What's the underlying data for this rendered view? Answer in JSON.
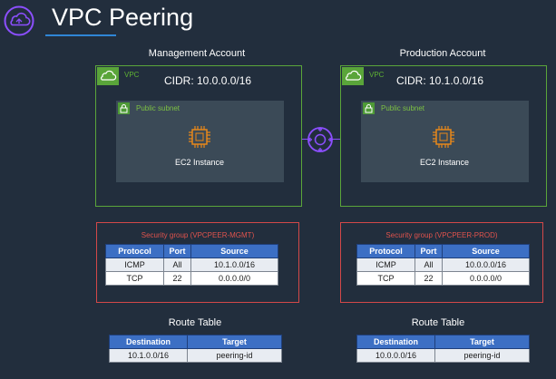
{
  "title": "VPC Peering",
  "accent_color": "#2f86d6",
  "peering_color": "#8c4fff",
  "vpc_border_color": "#5aa53a",
  "sg_border_color": "#d34848",
  "header_fill_color": "#3c6fc4",
  "accounts": [
    {
      "name": "Management Account",
      "vpc_label": "VPC",
      "cidr": "CIDR: 10.0.0.0/16",
      "subnet_label": "Public subnet",
      "instance_label": "EC2 Instance",
      "security_group": {
        "title": "Security group  (VPCPEER-MGMT)",
        "columns": [
          "Protocol",
          "Port",
          "Source"
        ],
        "rows": [
          [
            "ICMP",
            "All",
            "10.1.0.0/16"
          ],
          [
            "TCP",
            "22",
            "0.0.0.0/0"
          ]
        ]
      },
      "route_table": {
        "title": "Route Table",
        "columns": [
          "Destination",
          "Target"
        ],
        "rows": [
          [
            "10.1.0.0/16",
            "peering-id"
          ]
        ]
      }
    },
    {
      "name": "Production Account",
      "vpc_label": "VPC",
      "cidr": "CIDR: 10.1.0.0/16",
      "subnet_label": "Public subnet",
      "instance_label": "EC2 Instance",
      "security_group": {
        "title": "Security group  (VPCPEER-PROD)",
        "columns": [
          "Protocol",
          "Port",
          "Source"
        ],
        "rows": [
          [
            "ICMP",
            "All",
            "10.0.0.0/16"
          ],
          [
            "TCP",
            "22",
            "0.0.0.0/0"
          ]
        ]
      },
      "route_table": {
        "title": "Route Table",
        "columns": [
          "Destination",
          "Target"
        ],
        "rows": [
          [
            "10.0.0.0/16",
            "peering-id"
          ]
        ]
      }
    }
  ],
  "icons": {
    "logo": "vpc-cloud-icon",
    "vpc": "vpc-cloud-icon",
    "subnet": "lock-icon",
    "instance": "ec2-chip-icon",
    "peering": "peering-connection-icon"
  }
}
